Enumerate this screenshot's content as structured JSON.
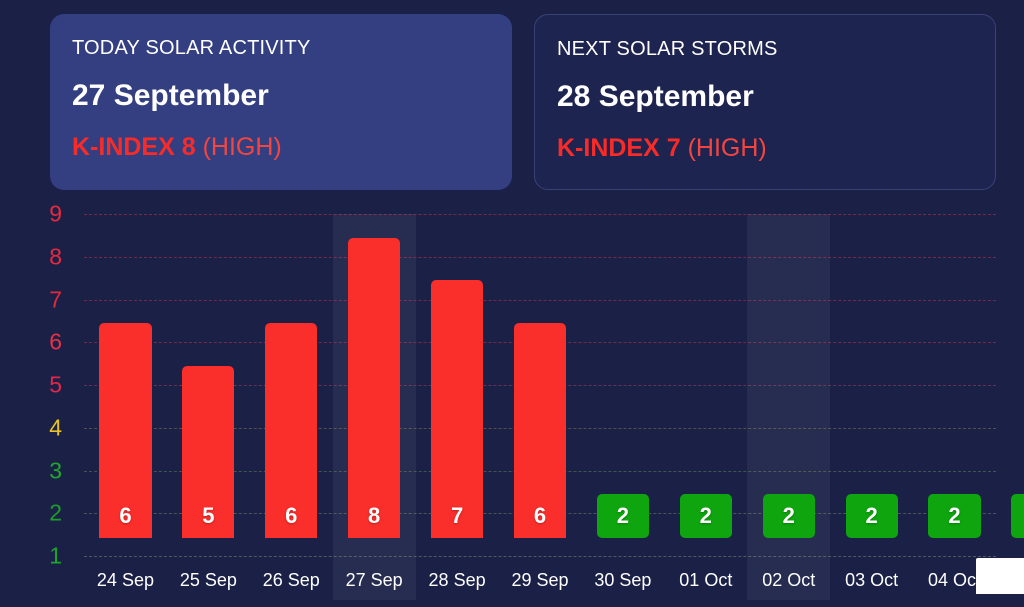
{
  "cards": [
    {
      "label": "TODAY SOLAR ACTIVITY",
      "date": "27 September",
      "k_main": "K-INDEX 8",
      "k_level": "(HIGH)",
      "accent": "#f92b28",
      "background": "#343f82"
    },
    {
      "label": "NEXT SOLAR STORMS",
      "date": "28 September",
      "k_main": "K-INDEX 7",
      "k_level": "(HIGH)",
      "accent": "#f92b28",
      "background": "#1e2450"
    }
  ],
  "chart_data": {
    "type": "bar",
    "title": "",
    "xlabel": "",
    "ylabel": "",
    "ylim": [
      1,
      9
    ],
    "grid": true,
    "legend": "none",
    "categories": [
      "24 Sep",
      "25 Sep",
      "26 Sep",
      "27 Sep",
      "28 Sep",
      "29 Sep",
      "30 Sep",
      "01 Oct",
      "02 Oct",
      "03 Oct",
      "04 Oct"
    ],
    "values": [
      6,
      5,
      6,
      8,
      7,
      6,
      2,
      2,
      2,
      2,
      2
    ],
    "bar_colors": [
      "#fa2e2b",
      "#fa2e2b",
      "#fa2e2b",
      "#fa2e2b",
      "#fa2e2b",
      "#fa2e2b",
      "#0ea50e",
      "#0ea50e",
      "#0ea50e",
      "#0ea50e",
      "#0ea50e"
    ],
    "value_labels": [
      "6",
      "5",
      "6",
      "8",
      "7",
      "6",
      "2",
      "2",
      "2",
      "2",
      "2"
    ],
    "y_ticks": [
      {
        "label": "9",
        "value": 9,
        "color": "#e8293f"
      },
      {
        "label": "8",
        "value": 8,
        "color": "#e8293f"
      },
      {
        "label": "7",
        "value": 7,
        "color": "#e22a3c"
      },
      {
        "label": "6",
        "value": 6,
        "color": "#e83046"
      },
      {
        "label": "5",
        "value": 5,
        "color": "#e3284a"
      },
      {
        "label": "4",
        "value": 4,
        "color": "#e8c321"
      },
      {
        "label": "3",
        "value": 3,
        "color": "#1fa82d"
      },
      {
        "label": "2",
        "value": 2,
        "color": "#1c9e2a"
      },
      {
        "label": "1",
        "value": 1,
        "color": "#1ba62b"
      }
    ],
    "gridline_colors": {
      "9": "#c0324a",
      "8": "#c0324a",
      "7": "#bb3049",
      "6": "#b8344d",
      "5": "#a6405a",
      "4": "#8a7350",
      "3": "#5f7f58",
      "2": "#6f8160",
      "1": "#7b8a6d"
    },
    "highlighted_categories": [
      "27 Sep",
      "02 Oct"
    ],
    "partial_bar_right_edge": {
      "value": 2,
      "color": "#0ea50e",
      "clipped": true
    }
  },
  "tooltip": {
    "visible": true,
    "background": "#ffffff",
    "text": ""
  }
}
